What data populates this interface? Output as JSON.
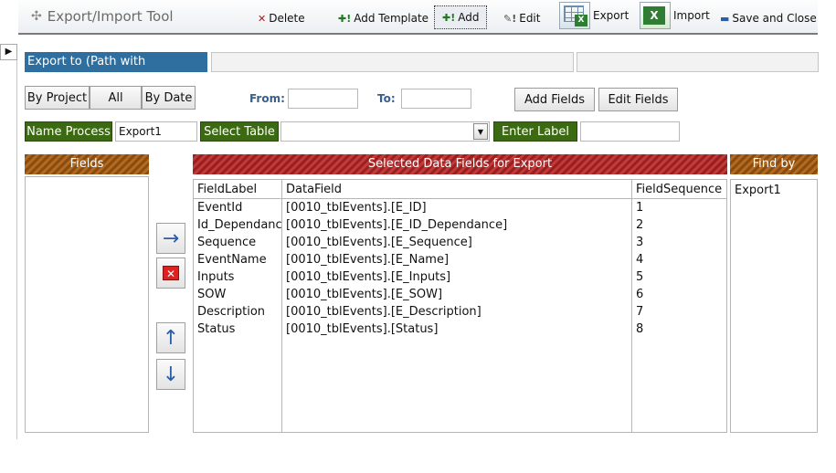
{
  "header": {
    "title": "Export/Import Tool",
    "delete_label": "Delete",
    "add_template_label": "Add Template",
    "add_label": "Add",
    "edit_label": "Edit",
    "export_label": "Export",
    "import_label": "Import",
    "save_close_label": "Save and Close"
  },
  "export_path": {
    "label": "Export to (Path with FileName)",
    "value1": "",
    "value2": ""
  },
  "filters": {
    "by_project": "By Project",
    "all": "All",
    "by_date": "By Date",
    "from_label": "From:",
    "from_value": "",
    "to_label": "To:",
    "to_value": "",
    "add_fields": "Add Fields",
    "edit_fields": "Edit Fields"
  },
  "process": {
    "name_label": "Name Process",
    "name_value": "Export1",
    "table_label": "Select Table",
    "table_value": "",
    "enter_label": "Enter Label",
    "enter_value": ""
  },
  "fields_panel": {
    "header": "Fields"
  },
  "selected": {
    "header": "Selected Data Fields for Export",
    "columns": [
      "FieldLabel",
      "DataField",
      "FieldSequence"
    ],
    "rows": [
      {
        "label": "EventId",
        "field": "[0010_tblEvents].[E_ID]",
        "seq": "1"
      },
      {
        "label": "Id_Dependance",
        "field": "[0010_tblEvents].[E_ID_Dependance]",
        "seq": "2"
      },
      {
        "label": "Sequence",
        "field": "[0010_tblEvents].[E_Sequence]",
        "seq": "3"
      },
      {
        "label": "EventName",
        "field": "[0010_tblEvents].[E_Name]",
        "seq": "4"
      },
      {
        "label": "Inputs",
        "field": "[0010_tblEvents].[E_Inputs]",
        "seq": "5"
      },
      {
        "label": "SOW",
        "field": "[0010_tblEvents].[E_SOW]",
        "seq": "6"
      },
      {
        "label": "Description",
        "field": "[0010_tblEvents].[E_Description]",
        "seq": "7"
      },
      {
        "label": "Status",
        "field": "[0010_tblEvents].[Status]",
        "seq": "8"
      }
    ]
  },
  "find_by": {
    "header": "Find by",
    "items": [
      "Export1"
    ]
  },
  "icons": {
    "move": "move-icon",
    "right_arrow": "→",
    "up_arrow": "↑",
    "down_arrow": "↓",
    "record_selector": "▶"
  }
}
